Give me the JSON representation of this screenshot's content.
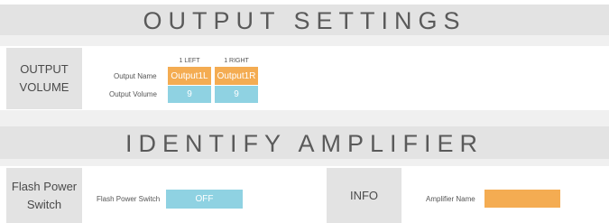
{
  "output_settings": {
    "title": "OUTPUT SETTINGS",
    "section_label": "OUTPUT\nVOLUME",
    "col1_header": "1 LEFT",
    "col2_header": "1 RIGHT",
    "row_name_label": "Output Name",
    "row_volume_label": "Output Volume",
    "col1_name": "Output1L",
    "col2_name": "Output1R",
    "col1_volume": "9",
    "col2_volume": "9"
  },
  "identify_amplifier": {
    "title": "IDENTIFY AMPLIFIER",
    "flash_section_label": "Flash Power\nSwitch",
    "flash_field_label": "Flash Power Switch",
    "flash_value": "OFF",
    "info_label": "INFO",
    "amp_name_label": "Amplifier Name",
    "amp_name_value": ""
  },
  "colors": {
    "orange": "#f4ac52",
    "blue": "#8fd2e2",
    "panel_gray": "#e3e3e3"
  }
}
